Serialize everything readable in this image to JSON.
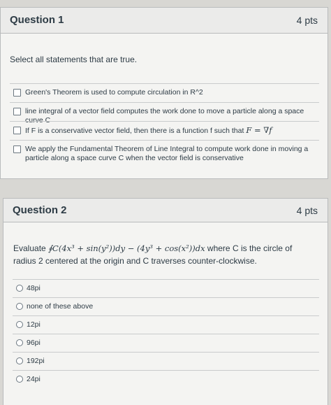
{
  "question1": {
    "title": "Question 1",
    "points": "4 pts",
    "prompt": "Select all statements that are true.",
    "answers": [
      "Green's Theorem is used to compute circulation in R^2",
      "line integral of a vector field computes the work done to move a particle along a space curve C",
      "If F is a conservative vector field, then there is a function f such that",
      "We apply the Fundamental Theorem of Line Integral to compute work done in moving a particle along a space curve C when the vector field is conservative"
    ],
    "answer3_math": "F = ∇f"
  },
  "question2": {
    "title": "Question 2",
    "points": "4 pts",
    "prompt_prefix": "Evaluate",
    "prompt_math": "∮C(4x³ + sin(y²))dy − (4y³ + cos(x²))dx",
    "prompt_suffix": "where C is the circle of radius 2 centered at the origin and C traverses counter-clockwise.",
    "options": [
      "48pi",
      "none of these above",
      "12pi",
      "96pi",
      "192pi",
      "24pi"
    ]
  }
}
